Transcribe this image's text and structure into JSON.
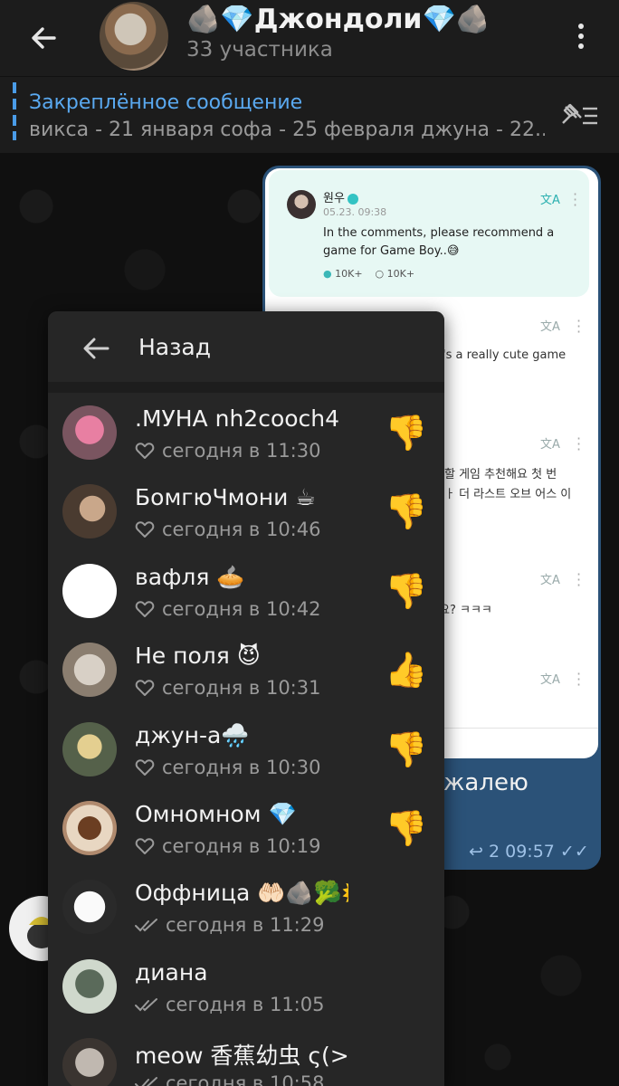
{
  "header": {
    "title": "🪨💎Джондоли💎🪨",
    "subtitle": "33 участника"
  },
  "pinned": {
    "label": "Закреплённое сообщение",
    "text": "викса - 21 января софа - 25 февраля джуна - 22..."
  },
  "shared_post": {
    "author": "원우",
    "date": "05.23. 09:38",
    "text": "In the comments, please recommend a game for Game Boy..😅",
    "likes": "10K+",
    "comments": "10K+",
    "comment_fragments": [
      "'s a really cute game",
      "할 게임 추천해요 첫 번",
      "ㅏ 더 라스트 오브 어스 이",
      "요? ㅋㅋㅋ"
    ]
  },
  "message": {
    "caption": "жалею",
    "replies": "2",
    "time": "09:57"
  },
  "reactions_popup": {
    "back_label": "Назад",
    "rows": [
      {
        "name": ".МУНА nh2cooch4",
        "time": "сегодня в 11:30",
        "status_icon": "heart",
        "reaction": "👎"
      },
      {
        "name": "БомгюЧмони ☕",
        "time": "сегодня в 10:46",
        "status_icon": "heart",
        "reaction": "👎"
      },
      {
        "name": "вафля 🥧",
        "time": "сегодня в 10:42",
        "status_icon": "heart",
        "reaction": "👎"
      },
      {
        "name": "Не поля 😈",
        "time": "сегодня в 10:31",
        "status_icon": "heart",
        "reaction": "👍"
      },
      {
        "name": "джун-а🌧️",
        "time": "сегодня в 10:30",
        "status_icon": "heart",
        "reaction": "👎"
      },
      {
        "name": "Омномном 💎",
        "time": "сегодня в 10:19",
        "status_icon": "heart",
        "reaction": "👎"
      },
      {
        "name": "Оффница 🤲🏻🪨🥦🌞🖼️",
        "time": "сегодня в 11:29",
        "status_icon": "double-check",
        "reaction": ""
      },
      {
        "name": "диана",
        "time": "сегодня в 11:05",
        "status_icon": "double-check",
        "reaction": ""
      },
      {
        "name": "meow 香蕉幼虫 ς(>_<. 💖",
        "time": "сегодня в 10:58",
        "status_icon": "double-check",
        "reaction": ""
      }
    ]
  },
  "colors": {
    "accent": "#5aa9f0",
    "bubble": "#2b5278",
    "popup_bg": "#262626",
    "header_bg": "#1c1c1c"
  }
}
